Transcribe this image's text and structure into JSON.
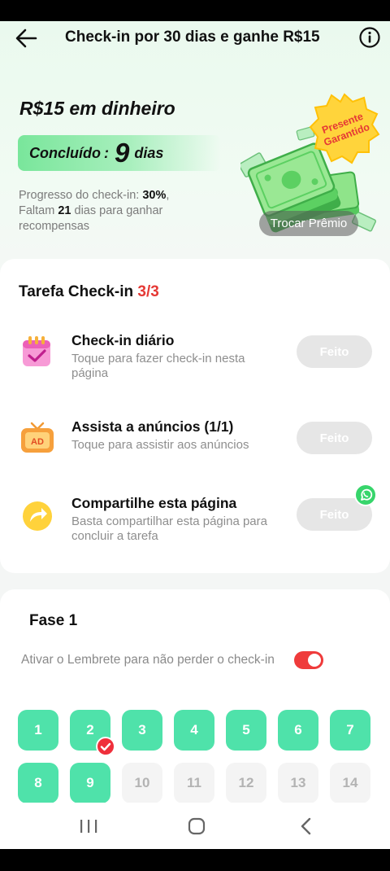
{
  "header": {
    "title": "Check-in por 30 dias e ganhe R$15"
  },
  "hero": {
    "title": "R$15 em dinheiro",
    "done_label": "Concluído",
    "done_sep": ":",
    "done_days": "9",
    "done_unit": "dias",
    "progress_prefix": "Progresso do check-in: ",
    "progress_value": "30%",
    "progress_comma": ",",
    "remaining_prefix": "Faltam ",
    "remaining_days": "21",
    "remaining_suffix": " dias para ganhar recompensas",
    "badge_line1": "Presente",
    "badge_line2": "Garantido",
    "exchange_button": "Trocar Prêmio"
  },
  "tasks": {
    "title": "Tarefa Check-in ",
    "count": "3/3",
    "items": [
      {
        "name": "Check-in diário",
        "desc": "Toque para fazer check-in nesta página",
        "status": "Feito",
        "icon": "calendar-icon"
      },
      {
        "name": "Assista a anúncios  (1/1)",
        "desc": "Toque para assistir aos anúncios",
        "status": "Feito",
        "icon": "ad-tv-icon"
      },
      {
        "name": "Compartilhe esta página",
        "desc": "Basta compartilhar esta página para concluir a tarefa",
        "status": "Feito",
        "icon": "share-arrow-icon"
      }
    ]
  },
  "phase": {
    "title": "Fase 1",
    "reminder": "Ativar o Lembrete para não perder o check-in",
    "reminder_on": true,
    "days": [
      "1",
      "2",
      "3",
      "4",
      "5",
      "6",
      "7",
      "8",
      "9",
      "10",
      "11",
      "12",
      "13",
      "14"
    ],
    "completed_days": 9
  },
  "colors": {
    "accent_green": "#4fe2aa",
    "red": "#e53935",
    "pill_green": "#79e69b"
  }
}
